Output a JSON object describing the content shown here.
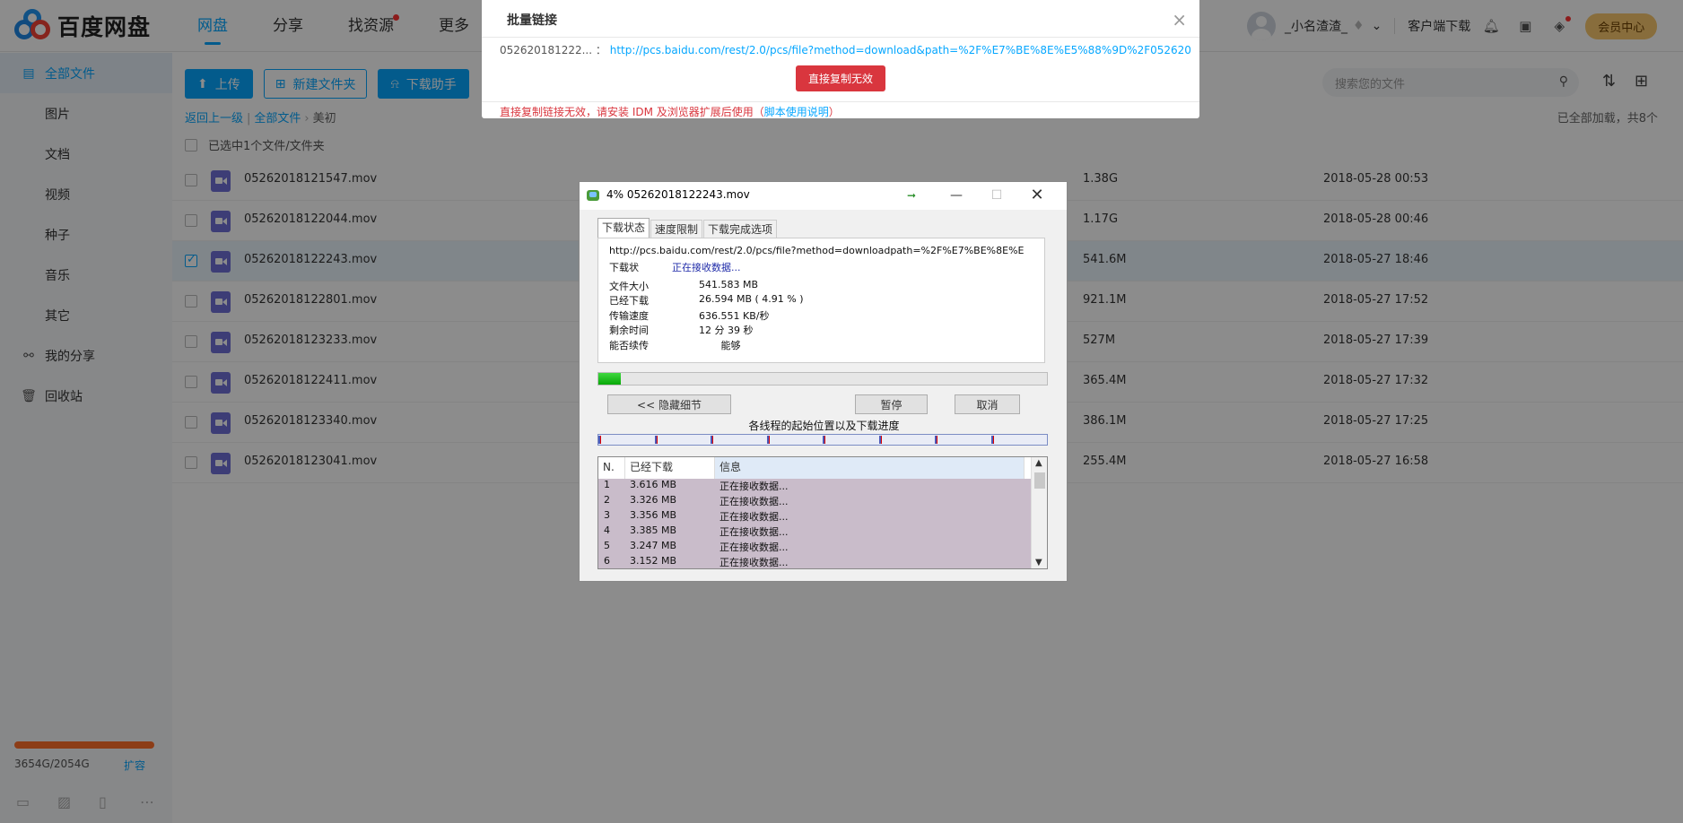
{
  "app": {
    "logo_text": "百度网盘",
    "nav": [
      {
        "label": "网盘",
        "active": true
      },
      {
        "label": "分享",
        "active": false
      },
      {
        "label": "找资源",
        "active": false,
        "dot": true
      },
      {
        "label": "更多",
        "active": false
      }
    ],
    "user": {
      "name": "_小名渣渣_",
      "client_download": "客户端下载",
      "vip_center": "会员中心"
    },
    "sidebar": {
      "items": [
        {
          "label": "全部文件",
          "icon": "folder-icon",
          "active": true,
          "top": true
        },
        {
          "label": "图片"
        },
        {
          "label": "文档"
        },
        {
          "label": "视频"
        },
        {
          "label": "种子"
        },
        {
          "label": "音乐"
        },
        {
          "label": "其它"
        },
        {
          "label": "我的分享",
          "icon": "share-icon",
          "top": true
        },
        {
          "label": "回收站",
          "icon": "trash-icon",
          "top": true
        }
      ],
      "quota_text": "3654G/2054G",
      "quota_expand": "扩容",
      "quota_fraction": 1.0
    },
    "toolbar": {
      "upload": "上传",
      "new_folder": "新建文件夹",
      "download_helper": "下载助手"
    },
    "search_placeholder": "搜索您的文件",
    "breadcrumb": {
      "back": "返回上一级",
      "all": "全部文件",
      "current": "美初"
    },
    "loaded_text": "已全部加载，共8个",
    "selected_text": "已选中1个文件/文件夹",
    "files": [
      {
        "name": "05262018121547.mov",
        "size": "1.38G",
        "date": "2018-05-28 00:53",
        "checked": false
      },
      {
        "name": "05262018122044.mov",
        "size": "1.17G",
        "date": "2018-05-28 00:46",
        "checked": false
      },
      {
        "name": "05262018122243.mov",
        "size": "541.6M",
        "date": "2018-05-27 18:46",
        "checked": true
      },
      {
        "name": "05262018122801.mov",
        "size": "921.1M",
        "date": "2018-05-27 17:52",
        "checked": false
      },
      {
        "name": "05262018123233.mov",
        "size": "527M",
        "date": "2018-05-27 17:39",
        "checked": false
      },
      {
        "name": "05262018122411.mov",
        "size": "365.4M",
        "date": "2018-05-27 17:32",
        "checked": false
      },
      {
        "name": "05262018123340.mov",
        "size": "386.1M",
        "date": "2018-05-27 17:25",
        "checked": false
      },
      {
        "name": "05262018123041.mov",
        "size": "255.4M",
        "date": "2018-05-27 16:58",
        "checked": false
      }
    ]
  },
  "batch_dialog": {
    "title": "批量链接",
    "filename": "052620181222... ：",
    "link": "http://pcs.baidu.com/rest/2.0/pcs/file?method=download&path=%2F%E7%BE%8E%E5%88%9D%2F05262018...",
    "copy_button": "直接复制无效",
    "footer_warning": "直接复制链接无效，请安装 IDM 及浏览器扩展后使用（",
    "footer_help": "脚本使用说明",
    "footer_end": "）"
  },
  "idm": {
    "title": "4% 05262018122243.mov",
    "tabs": [
      "下载状态",
      "速度限制",
      "下载完成选项"
    ],
    "url": "http://pcs.baidu.com/rest/2.0/pcs/file?method=downloadpath=%2F%E7%BE%8E%E",
    "status_label": "下载状",
    "status_value": "正在接收数据...",
    "rows": [
      {
        "label": "文件大小",
        "value": "541.583  MB"
      },
      {
        "label": "已经下载",
        "value": "26.594  MB  ( 4.91 % )"
      },
      {
        "label": "传输速度",
        "value": "636.551  KB/秒"
      },
      {
        "label": "剩余时间",
        "value": "12 分 39 秒"
      },
      {
        "label": "能否续传",
        "value": "       能够"
      }
    ],
    "progress_percent": 4.91,
    "hide_details": "<< 隐藏细节",
    "pause": "暂停",
    "cancel": "取消",
    "thread_caption": "各线程的起始位置以及下载进度",
    "thread_positions": [
      0.0,
      0.125,
      0.25,
      0.375,
      0.5,
      0.625,
      0.75,
      0.875
    ],
    "table_headers": [
      "N.",
      "已经下载",
      "信息"
    ],
    "threads": [
      {
        "n": "1",
        "downloaded": "3.616  MB",
        "info": "正在接收数据..."
      },
      {
        "n": "2",
        "downloaded": "3.326  MB",
        "info": "正在接收数据..."
      },
      {
        "n": "3",
        "downloaded": "3.356  MB",
        "info": "正在接收数据..."
      },
      {
        "n": "4",
        "downloaded": "3.385  MB",
        "info": "正在接收数据..."
      },
      {
        "n": "5",
        "downloaded": "3.247  MB",
        "info": "正在接收数据..."
      },
      {
        "n": "6",
        "downloaded": "3.152  MB",
        "info": "正在接收数据..."
      }
    ]
  }
}
